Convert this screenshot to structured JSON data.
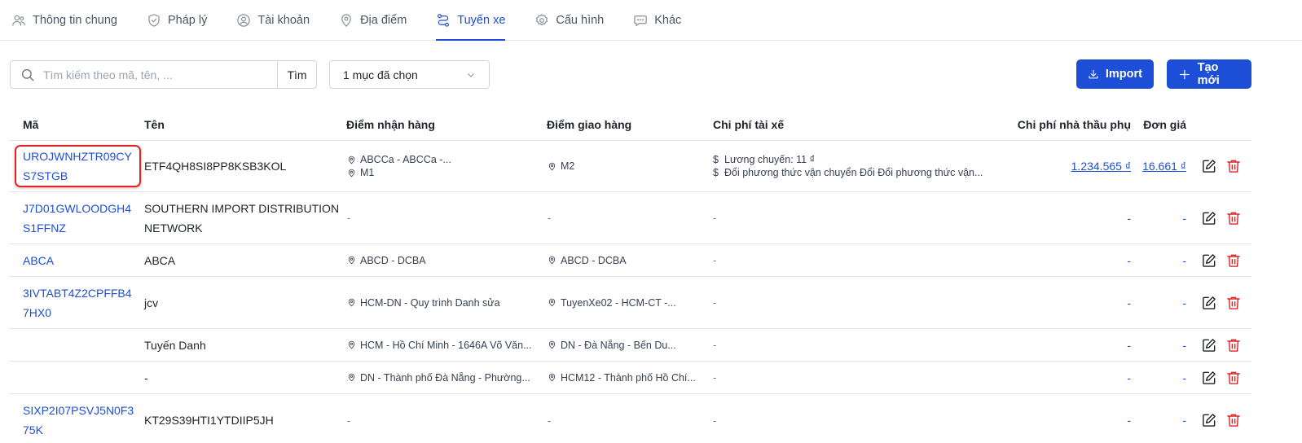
{
  "tabs": [
    {
      "label": "Thông tin chung",
      "icon": "users-icon"
    },
    {
      "label": "Pháp lý",
      "icon": "shield-check-icon"
    },
    {
      "label": "Tài khoản",
      "icon": "user-circle-icon"
    },
    {
      "label": "Địa điểm",
      "icon": "map-pin-icon"
    },
    {
      "label": "Tuyến xe",
      "icon": "route-icon",
      "active": true
    },
    {
      "label": "Cấu hình",
      "icon": "gear-icon"
    },
    {
      "label": "Khác",
      "icon": "more-chat-icon"
    }
  ],
  "toolbar": {
    "search_placeholder": "Tìm kiếm theo mã, tên, ...",
    "search_button": "Tìm",
    "filter_selected": "1 mục đã chọn",
    "import_label": "Import",
    "create_label": "Tạo mới"
  },
  "table": {
    "headers": {
      "ma": "Mã",
      "ten": "Tên",
      "nhan": "Điểm nhận hàng",
      "giao": "Điểm giao hàng",
      "cp_tai_xe": "Chi phí tài xế",
      "cp_ntp": "Chi phí nhà thầu phụ",
      "don_gia": "Đơn giá"
    },
    "rows": [
      {
        "ma": "UROJWNHZTR09CYS7STGB",
        "ten": "ETF4QH8SI8PP8KSB3KOL",
        "nhan": [
          "ABCCa - ABCCa -...",
          "M1"
        ],
        "giao": [
          "M2"
        ],
        "cp_tai_xe": [
          "Lương chuyến: 11 ₫",
          "Đổi phương thức vận chuyển Đổi Đổi phương thức vận..."
        ],
        "cp_ntp": "1.234.565 ₫",
        "don_gia": "16.661 ₫"
      },
      {
        "ma": "J7D01GWLOODGH4S1FFNZ",
        "ten": "SOUTHERN IMPORT DISTRIBUTION NETWORK",
        "nhan": [],
        "giao": [],
        "cp_tai_xe": [],
        "cp_ntp": "-",
        "don_gia": "-"
      },
      {
        "ma": "ABCA",
        "ten": "ABCA",
        "nhan": [
          "ABCD - DCBA"
        ],
        "giao": [
          "ABCD - DCBA"
        ],
        "cp_tai_xe": [],
        "cp_ntp": "-",
        "don_gia": "-"
      },
      {
        "ma": "3IVTABT4Z2CPFFB47HX0",
        "ten": "jcv",
        "nhan": [
          "HCM-DN - Quy trình Danh sửa"
        ],
        "giao": [
          "TuyenXe02 - HCM-CT -..."
        ],
        "cp_tai_xe": [],
        "cp_ntp": "-",
        "don_gia": "-"
      },
      {
        "ma": "",
        "ten": "Tuyến Danh",
        "nhan": [
          "HCM - Hồ Chí Minh - 1646A Võ Văn..."
        ],
        "giao": [
          "DN - Đà Nẵng - Bến Du..."
        ],
        "cp_tai_xe": [],
        "cp_ntp": "-",
        "don_gia": "-"
      },
      {
        "ma": "",
        "ten": "-",
        "nhan": [
          "DN - Thành phố Đà Nẵng - Phường..."
        ],
        "giao": [
          "HCM12 - Thành phố Hồ Chí..."
        ],
        "cp_tai_xe": [],
        "cp_ntp": "-",
        "don_gia": "-"
      },
      {
        "ma": "SIXP2I07PSVJ5N0F375K",
        "ten": "KT29S39HTI1YTDIIP5JH",
        "nhan": [],
        "giao": [],
        "cp_tai_xe": [],
        "cp_ntp": "-",
        "don_gia": "-"
      }
    ],
    "empty": "-",
    "money_symbol": "$"
  },
  "colors": {
    "accent": "#1d4ed8",
    "danger": "#dc2626",
    "border": "#e5e7eb"
  }
}
